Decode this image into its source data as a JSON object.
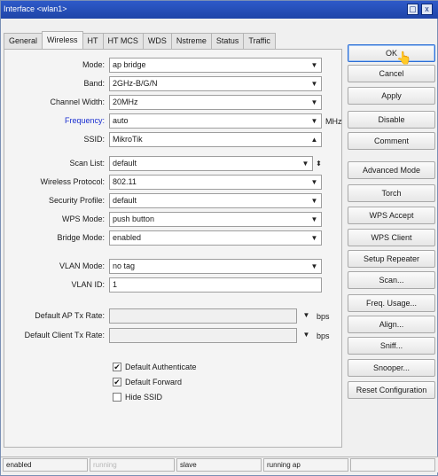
{
  "window": {
    "title": "Interface <wlan1>",
    "maximize_glyph": "▢",
    "close_glyph": "x"
  },
  "tabs": [
    {
      "label": "General",
      "active": false
    },
    {
      "label": "Wireless",
      "active": true
    },
    {
      "label": "HT",
      "active": false
    },
    {
      "label": "HT MCS",
      "active": false
    },
    {
      "label": "WDS",
      "active": false
    },
    {
      "label": "Nstreme",
      "active": false
    },
    {
      "label": "Status",
      "active": false
    },
    {
      "label": "Traffic",
      "active": false
    }
  ],
  "form": {
    "mode": {
      "label": "Mode:",
      "value": "ap bridge"
    },
    "band": {
      "label": "Band:",
      "value": "2GHz-B/G/N"
    },
    "channel_width": {
      "label": "Channel Width:",
      "value": "20MHz"
    },
    "frequency": {
      "label": "Frequency:",
      "value": "auto",
      "unit": "MHz"
    },
    "ssid": {
      "label": "SSID:",
      "value": "MikroTik"
    },
    "scan_list": {
      "label": "Scan List:",
      "value": "default"
    },
    "wireless_protocol": {
      "label": "Wireless Protocol:",
      "value": "802.11"
    },
    "security_profile": {
      "label": "Security Profile:",
      "value": "default"
    },
    "wps_mode": {
      "label": "WPS Mode:",
      "value": "push button"
    },
    "bridge_mode": {
      "label": "Bridge Mode:",
      "value": "enabled"
    },
    "vlan_mode": {
      "label": "VLAN Mode:",
      "value": "no tag"
    },
    "vlan_id": {
      "label": "VLAN ID:",
      "value": "1"
    },
    "default_ap_tx_rate": {
      "label": "Default AP Tx Rate:",
      "value": "",
      "unit": "bps"
    },
    "default_client_tx_rate": {
      "label": "Default Client Tx Rate:",
      "value": "",
      "unit": "bps"
    },
    "default_authenticate": {
      "label": "Default Authenticate",
      "checked": true
    },
    "default_forward": {
      "label": "Default Forward",
      "checked": true
    },
    "hide_ssid": {
      "label": "Hide SSID",
      "checked": false
    }
  },
  "glyphs": {
    "dropdown": "▼",
    "collapse_up": "▲",
    "updown": "⬍",
    "check": "✔"
  },
  "buttons": [
    "OK",
    "Cancel",
    "Apply",
    "Disable",
    "Comment",
    "Advanced Mode",
    "Torch",
    "WPS Accept",
    "WPS Client",
    "Setup Repeater",
    "Scan...",
    "Freq. Usage...",
    "Align...",
    "Sniff...",
    "Snooper...",
    "Reset Configuration"
  ],
  "status": {
    "state": "enabled",
    "running": "running",
    "role": "slave",
    "ap_state": "running ap",
    "extra": ""
  }
}
